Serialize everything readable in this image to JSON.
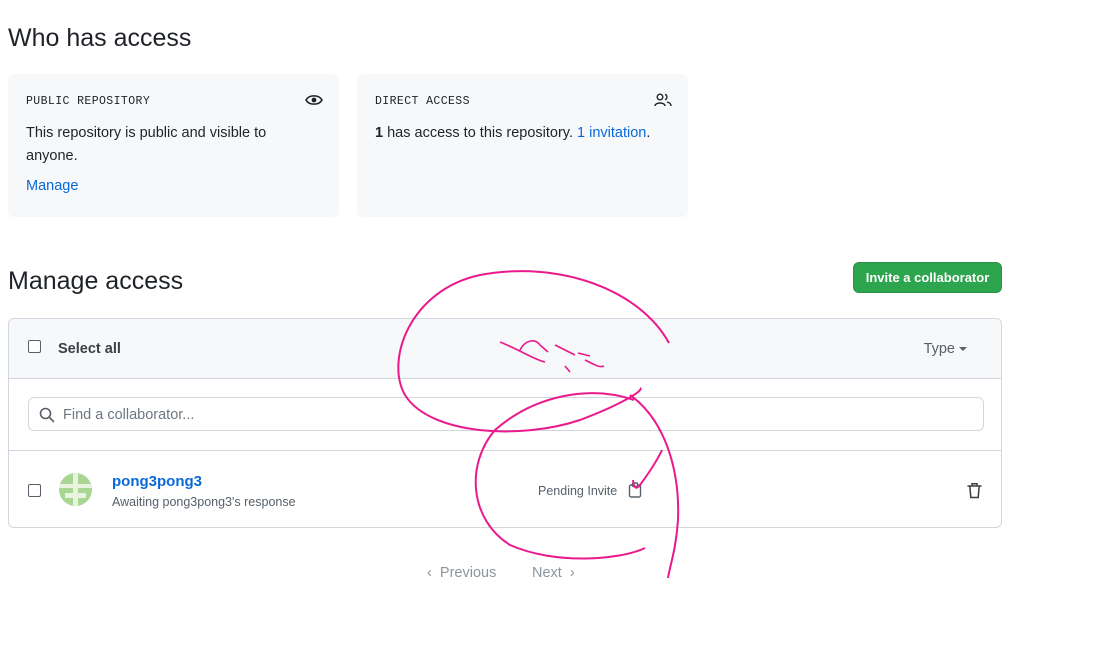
{
  "who_has_access": {
    "title": "Who has access",
    "public_card": {
      "label": "PUBLIC REPOSITORY",
      "text": "This repository is public and visible to anyone.",
      "manage_link": "Manage",
      "icon": "eye-icon"
    },
    "direct_card": {
      "label": "DIRECT ACCESS",
      "count": "1",
      "text": " has access to this repository. ",
      "invitation_link": "1 invitation",
      "suffix": ".",
      "icon": "people-icon"
    }
  },
  "manage_access": {
    "title": "Manage access",
    "invite_button": "Invite a collaborator",
    "select_all": "Select all",
    "type_dropdown": "Type",
    "search_placeholder": "Find a collaborator...",
    "members": [
      {
        "name": "pong3pong3",
        "status": "Awaiting pong3pong3's response",
        "state": "Pending Invite"
      }
    ]
  },
  "pagination": {
    "previous": "Previous",
    "next": "Next"
  },
  "colors": {
    "link": "#0969da",
    "button_green": "#2da44e",
    "annotation": "#ea1a8c"
  }
}
